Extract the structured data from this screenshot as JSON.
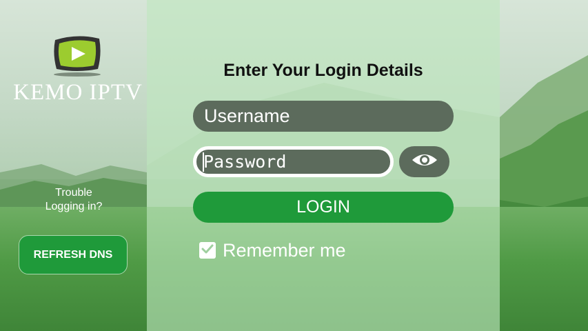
{
  "brand": {
    "name": "KEMO IPTV",
    "logo_icon": "tv-play-icon",
    "colors": {
      "logo_green": "#9ccc2f",
      "logo_frame": "#333333"
    }
  },
  "sidebar": {
    "trouble_text": "Trouble\nLogging in?",
    "refresh_dns_label": "REFRESH DNS"
  },
  "form": {
    "title": "Enter Your Login Details",
    "username_placeholder": "Username",
    "password_placeholder": "Password",
    "show_password_icon": "eye-icon",
    "login_label": "LOGIN",
    "remember_label": "Remember me",
    "remember_checked": true
  },
  "colors": {
    "accent_green": "#1f9a3a",
    "field_gray": "#5c6b5c",
    "panel_tint": "#bee6be"
  }
}
